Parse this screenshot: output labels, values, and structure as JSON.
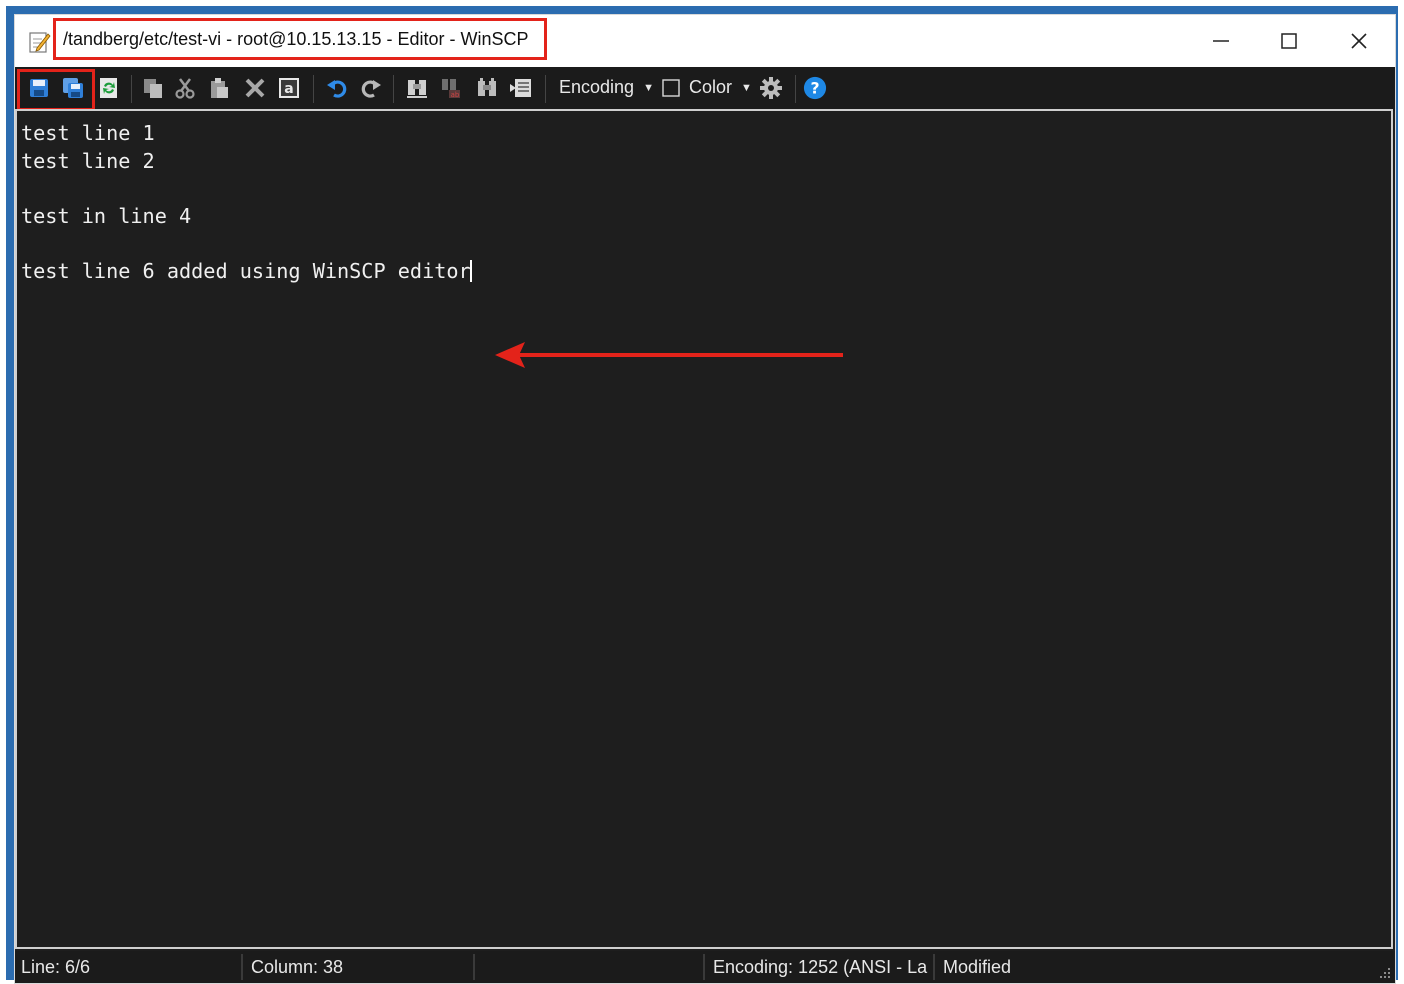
{
  "window": {
    "title": "/tandberg/etc/test-vi - root@10.15.13.15 - Editor - WinSCP",
    "minimize_glyph": "—",
    "maximize_glyph": "☐",
    "close_glyph": "✕"
  },
  "toolbar": {
    "encoding_label": "Encoding",
    "color_label": "Color",
    "items": [
      {
        "name": "save-icon",
        "tooltip": ""
      },
      {
        "name": "save-all-icon"
      },
      {
        "name": "reload-icon"
      },
      {
        "name": "copy-icon"
      },
      {
        "name": "cut-icon"
      },
      {
        "name": "paste-icon"
      },
      {
        "name": "delete-icon"
      },
      {
        "name": "select-all-icon"
      },
      {
        "name": "undo-icon"
      },
      {
        "name": "redo-icon"
      },
      {
        "name": "find-icon"
      },
      {
        "name": "replace-icon"
      },
      {
        "name": "find-next-icon"
      },
      {
        "name": "go-to-line-icon"
      },
      {
        "name": "settings-icon"
      },
      {
        "name": "help-icon"
      }
    ]
  },
  "editor": {
    "lines": [
      "test line 1",
      "test line 2",
      "",
      "test in line 4",
      "",
      "test line 6 added using WinSCP editor"
    ]
  },
  "status": {
    "line": "Line: 6/6",
    "column": "Column: 38",
    "empty": "",
    "encoding": "Encoding: 1252  (ANSI - La",
    "modified": "Modified"
  },
  "colors": {
    "highlight": "#e3231a",
    "editor_bg": "#1e1e1e",
    "text": "#f0f0f0",
    "accent_blue": "#1e88e5"
  }
}
